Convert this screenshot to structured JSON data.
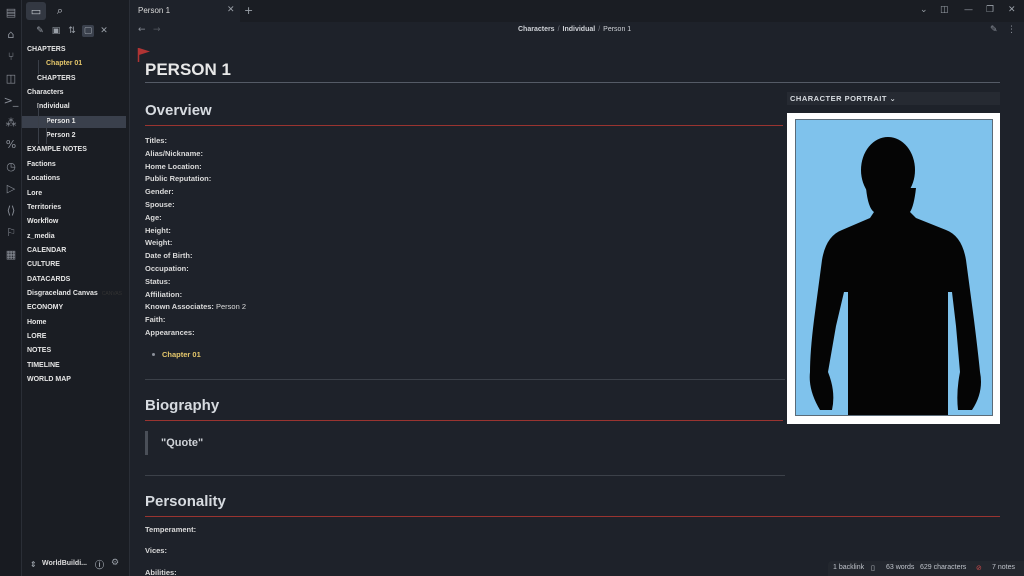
{
  "tab": {
    "title": "Person 1"
  },
  "breadcrumb": [
    "Characters",
    "Individual",
    "Person 1"
  ],
  "sidebar": {
    "items": [
      {
        "label": "CHAPTERS",
        "indent": 0
      },
      {
        "label": "Chapter 01",
        "indent": 2,
        "yellow": true
      },
      {
        "label": "CHAPTERS",
        "indent": 1
      },
      {
        "label": "Characters",
        "indent": 0
      },
      {
        "label": "Individual",
        "indent": 1
      },
      {
        "label": "Person 1",
        "indent": 2,
        "active": true
      },
      {
        "label": "Person 2",
        "indent": 2
      },
      {
        "label": "EXAMPLE NOTES",
        "indent": 0
      },
      {
        "label": "Factions",
        "indent": 0
      },
      {
        "label": "Locations",
        "indent": 0
      },
      {
        "label": "Lore",
        "indent": 0
      },
      {
        "label": "Territories",
        "indent": 0
      },
      {
        "label": "Workflow",
        "indent": 0
      },
      {
        "label": "z_media",
        "indent": 0
      },
      {
        "label": "CALENDAR",
        "indent": 0
      },
      {
        "label": "CULTURE",
        "indent": 0
      },
      {
        "label": "DATACARDS",
        "indent": 0
      },
      {
        "label": "Disgraceland Canvas",
        "indent": 0,
        "badge": "CANVAS"
      },
      {
        "label": "ECONOMY",
        "indent": 0
      },
      {
        "label": "Home",
        "indent": 0
      },
      {
        "label": "LORE",
        "indent": 0
      },
      {
        "label": "NOTES",
        "indent": 0
      },
      {
        "label": "TIMELINE",
        "indent": 0
      },
      {
        "label": "WORLD MAP",
        "indent": 0
      }
    ],
    "vault_name": "WorldBuildi..."
  },
  "note": {
    "title": "PERSON 1",
    "overview_heading": "Overview",
    "fields": [
      {
        "label": "Titles:",
        "value": ""
      },
      {
        "label": "Alias/Nickname:",
        "value": ""
      },
      {
        "label": "Home Location:",
        "value": ""
      },
      {
        "label": "Public Reputation:",
        "value": ""
      },
      {
        "label": "Gender:",
        "value": ""
      },
      {
        "label": "Spouse:",
        "value": ""
      },
      {
        "label": "Age:",
        "value": ""
      },
      {
        "label": "Height:",
        "value": ""
      },
      {
        "label": "Weight:",
        "value": ""
      },
      {
        "label": "Date of Birth:",
        "value": ""
      },
      {
        "label": "Occupation:",
        "value": ""
      },
      {
        "label": "Status:",
        "value": ""
      },
      {
        "label": "Affiliation:",
        "value": ""
      },
      {
        "label": "Known Associates:",
        "value": " Person 2"
      },
      {
        "label": "Faith:",
        "value": ""
      },
      {
        "label": "Appearances:",
        "value": ""
      }
    ],
    "appearance_link": "Chapter 01",
    "biography_heading": "Biography",
    "quote": "\"Quote\"",
    "personality_heading": "Personality",
    "personality_fields": [
      "Temperament:",
      "Vices:",
      "Abilities:"
    ],
    "portrait_label": "CHARACTER PORTRAIT",
    "portrait_chevron": "⌄"
  },
  "statusbar": {
    "backlinks": "1 backlink",
    "words": "63 words",
    "characters": "629 characters",
    "notes": "7 notes"
  },
  "colors": {
    "background": "#1e222a",
    "heading_rule": "#9a3430",
    "link_yellow": "#e5c76b",
    "portrait_bg": "#7fc2ec",
    "flag": "#b03434"
  },
  "icons": [
    "file-explorer-icon",
    "search-icon",
    "new-note-icon",
    "new-folder-icon",
    "sort-icon",
    "collapse-icon",
    "close-icon",
    "help-icon",
    "settings-icon",
    "flag-icon",
    "silhouette-icon"
  ]
}
